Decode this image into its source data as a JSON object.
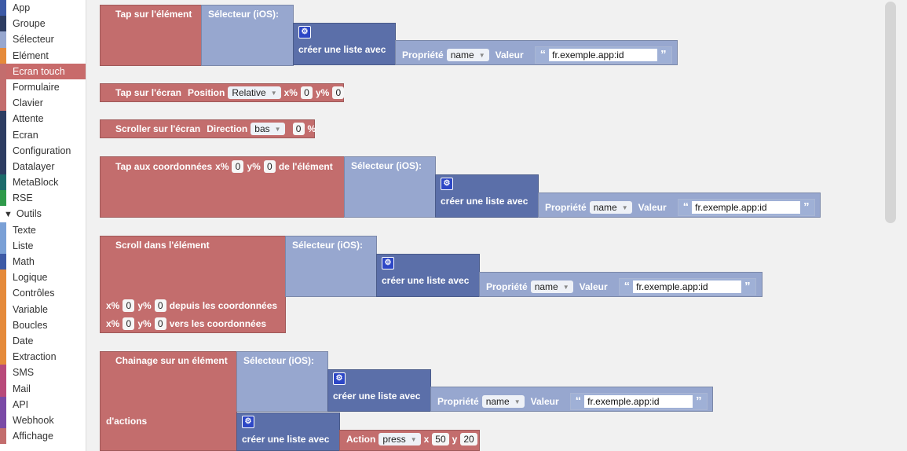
{
  "sidebar": {
    "categories": [
      {
        "label": "App",
        "color": "#3d5aa6"
      },
      {
        "label": "Groupe",
        "color": "#2d3d62"
      },
      {
        "label": "Sélecteur",
        "color": "#97a7cf"
      },
      {
        "label": "Elément",
        "color": "#e58a3a"
      },
      {
        "label": "Ecran touch",
        "color": "#c36d6d",
        "selected": true
      },
      {
        "label": "Formulaire",
        "color": "#c36d6d"
      },
      {
        "label": "Clavier",
        "color": "#c36d6d"
      },
      {
        "label": "Attente",
        "color": "#2d3d62"
      },
      {
        "label": "Ecran",
        "color": "#2d3d62"
      },
      {
        "label": "Configuration",
        "color": "#2d3d62"
      },
      {
        "label": "Datalayer",
        "color": "#2d3d62"
      },
      {
        "label": "MetaBlock",
        "color": "#1d6b6b"
      },
      {
        "label": "RSE",
        "color": "#2f9a4a"
      }
    ],
    "tools_header": "Outils",
    "tools": [
      {
        "label": "Texte",
        "color": "#7aa0d6"
      },
      {
        "label": "Liste",
        "color": "#7aa0d6"
      },
      {
        "label": "Math",
        "color": "#3d5aa6"
      },
      {
        "label": "Logique",
        "color": "#e58a3a"
      },
      {
        "label": "Contrôles",
        "color": "#e58a3a"
      },
      {
        "label": "Variable",
        "color": "#e58a3a"
      },
      {
        "label": "Boucles",
        "color": "#e58a3a"
      },
      {
        "label": "Date",
        "color": "#e58a3a"
      },
      {
        "label": "Extraction",
        "color": "#e58a3a"
      },
      {
        "label": "SMS",
        "color": "#b84a7a"
      },
      {
        "label": "Mail",
        "color": "#b84a7a"
      },
      {
        "label": "API",
        "color": "#7a4aa6"
      },
      {
        "label": "Webhook",
        "color": "#7a4aa6"
      },
      {
        "label": "Affichage",
        "color": "#c36d6d"
      }
    ]
  },
  "blocks": {
    "tap_element": {
      "label": "Tap sur l'élément",
      "selector": "Sélecteur (iOS):",
      "list": "créer une liste avec",
      "prop_label": "Propriété",
      "prop_value": "name",
      "value_label": "Valeur",
      "value": "fr.exemple.app:id"
    },
    "tap_screen": {
      "label": "Tap sur l'écran",
      "position_label": "Position",
      "position_value": "Relative",
      "x_label": "x%",
      "x": "0",
      "y_label": "y%",
      "y": "0"
    },
    "scroll_screen": {
      "label": "Scroller sur l'écran",
      "direction_label": "Direction",
      "direction_value": "bas",
      "amount": "0",
      "unit": "%"
    },
    "tap_coords": {
      "label": "Tap aux coordonnées",
      "x_label": "x%",
      "x": "0",
      "y_label": "y%",
      "y": "0",
      "suffix": "de l'élément",
      "selector": "Sélecteur (iOS):",
      "list": "créer une liste avec",
      "prop_label": "Propriété",
      "prop_value": "name",
      "value_label": "Valeur",
      "value": "fr.exemple.app:id"
    },
    "scroll_element": {
      "label": "Scroll dans l'élément",
      "selector": "Sélecteur (iOS):",
      "list": "créer une liste avec",
      "prop_label": "Propriété",
      "prop_value": "name",
      "value_label": "Valeur",
      "value": "fr.exemple.app:id",
      "from_x_label": "x%",
      "from_x": "0",
      "from_y_label": "y%",
      "from_y": "0",
      "from_label": "depuis les coordonnées",
      "to_x_label": "x%",
      "to_x": "0",
      "to_y_label": "y%",
      "to_y": "0",
      "to_label": "vers les coordonnées"
    },
    "chain_element": {
      "label": "Chainage sur un élément",
      "selector": "Sélecteur (iOS):",
      "list": "créer une liste avec",
      "prop_label": "Propriété",
      "prop_value": "name",
      "value_label": "Valeur",
      "value": "fr.exemple.app:id",
      "actions_label": "d'actions",
      "actions_list": "créer une liste avec",
      "action_label": "Action",
      "action_value": "press",
      "ax_label": "x",
      "ax": "50",
      "ay_label": "y",
      "ay": "20"
    }
  }
}
